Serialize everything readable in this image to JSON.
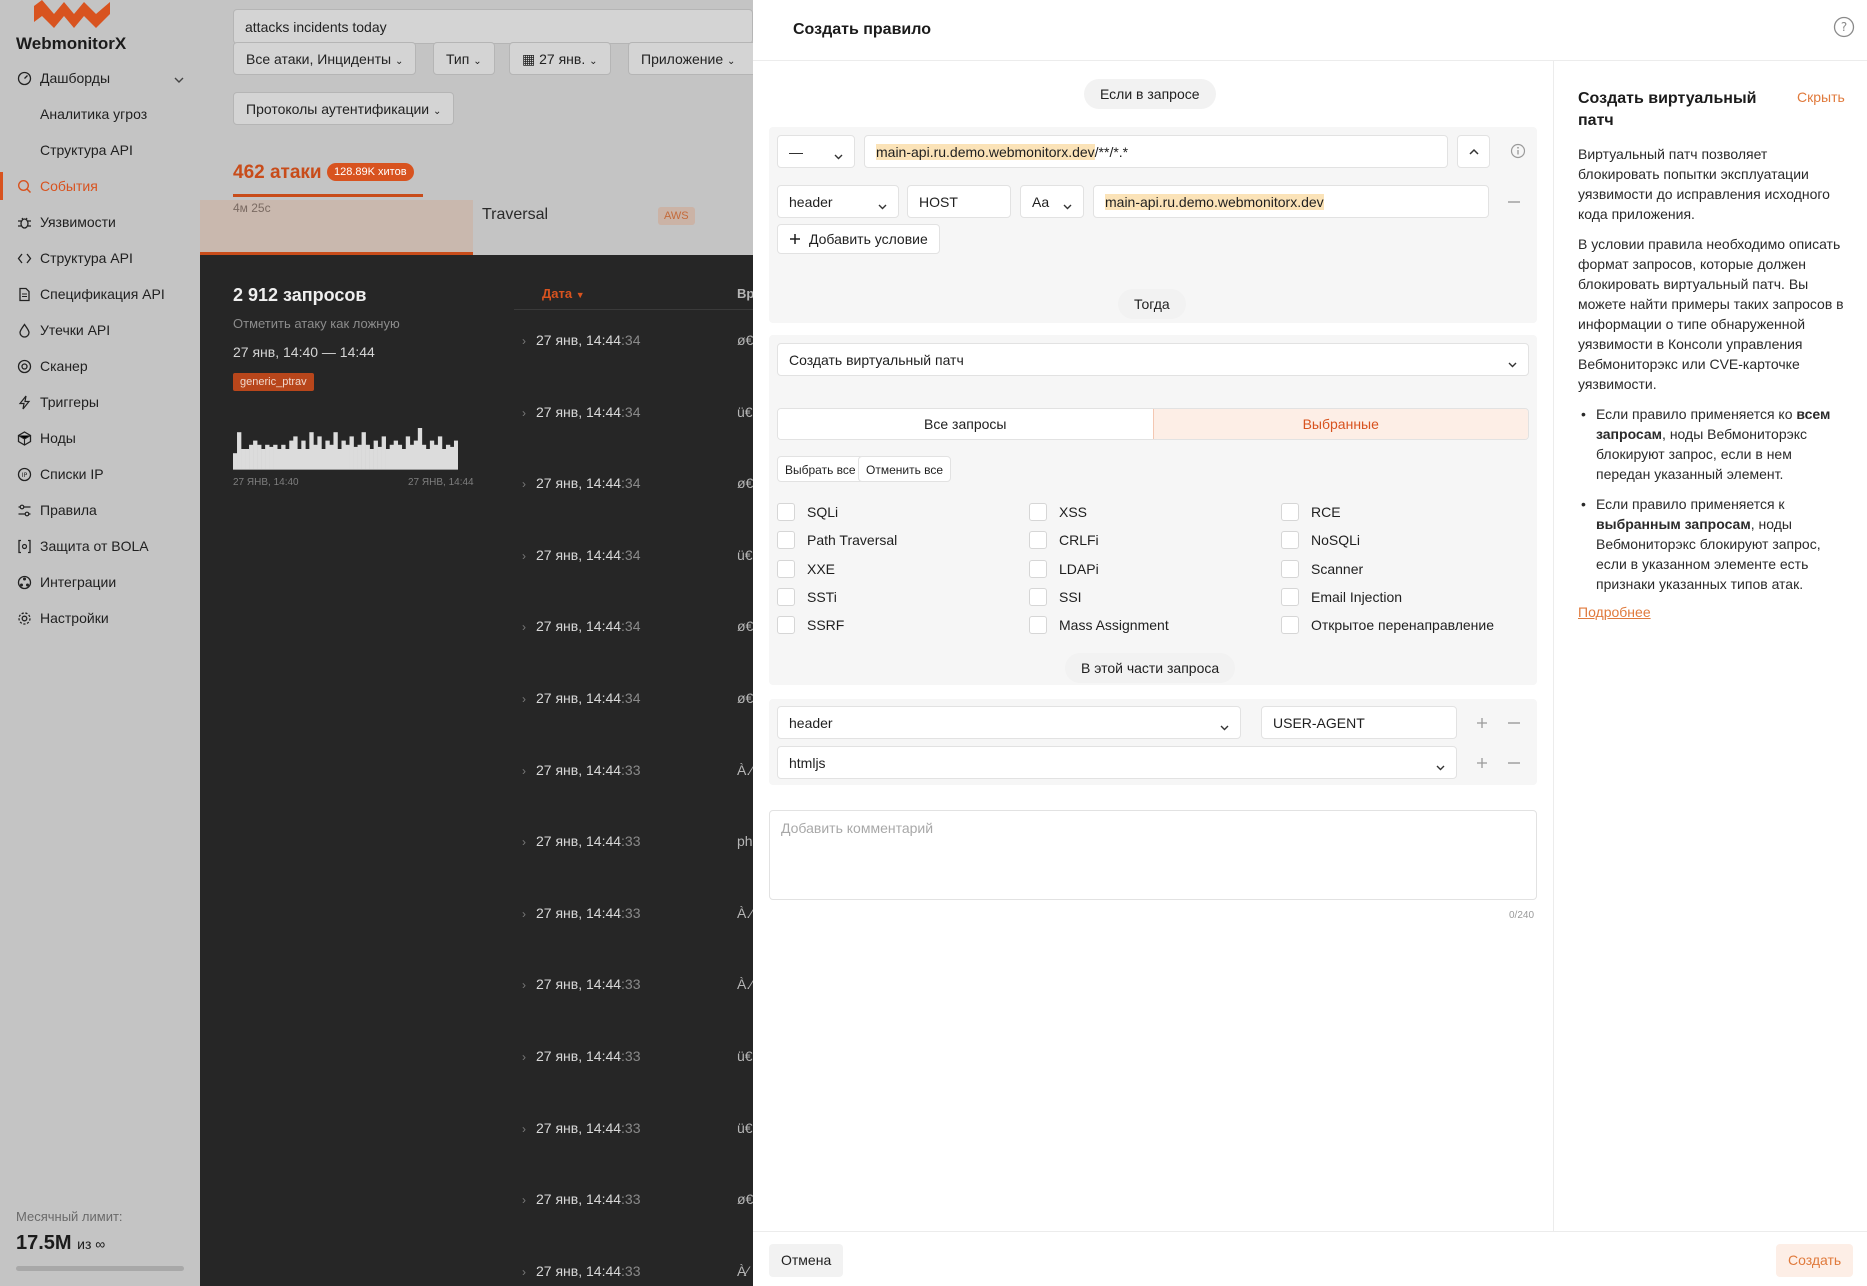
{
  "sidebar": {
    "logo": "WebmonitorX",
    "items": [
      {
        "label": "Дашборды",
        "icon": "dashboard-icon"
      },
      {
        "label": "Аналитика угроз",
        "sub": true
      },
      {
        "label": "Структура API",
        "sub": true
      },
      {
        "label": "События",
        "icon": "search-icon",
        "active": true
      },
      {
        "label": "Уязвимости",
        "icon": "bug-icon"
      },
      {
        "label": "Структура API",
        "icon": "code-icon"
      },
      {
        "label": "Спецификация API",
        "icon": "document-icon"
      },
      {
        "label": "Утечки API",
        "icon": "drop-icon"
      },
      {
        "label": "Сканер",
        "icon": "scanner-icon"
      },
      {
        "label": "Триггеры",
        "icon": "lightning-icon"
      },
      {
        "label": "Ноды",
        "icon": "nodes-icon"
      },
      {
        "label": "Списки IP",
        "icon": "ip-icon"
      },
      {
        "label": "Правила",
        "icon": "sliders-icon"
      },
      {
        "label": "Защита от BOLA",
        "icon": "brackets-icon"
      },
      {
        "label": "Интеграции",
        "icon": "integrations-icon"
      },
      {
        "label": "Настройки",
        "icon": "gear-icon"
      }
    ],
    "limit_label": "Месячный лимит:",
    "limit_value": "17.5M",
    "limit_of": "из ∞"
  },
  "main": {
    "search_value": "attacks incidents today",
    "filters": [
      "Все атаки, Инциденты",
      "Тип",
      "27 янв.",
      "Приложение",
      "Протоколы аутентификации"
    ],
    "attacks_count": "462 атаки",
    "hits_badge": "128.89K хитов",
    "tab_time": "4м 25с",
    "attack_type": "Traversal",
    "aws_badge": "AWS",
    "requests_title": "2 912 запросов",
    "mark_false": "Отметить атаку как ложную",
    "time_range": "27 янв, 14:40 — 14:44",
    "tag": "generic_ptrav",
    "mini_axis_start": "27 ЯНВ, 14:40",
    "mini_axis_end": "27 ЯНВ, 14:44",
    "mini_bars": [
      0.4,
      0.9,
      0.5,
      0.5,
      0.6,
      0.7,
      0.6,
      0.5,
      0.6,
      0.55,
      0.6,
      0.5,
      0.6,
      0.5,
      0.7,
      0.8,
      0.5,
      0.7,
      0.5,
      0.9,
      0.6,
      0.8,
      0.5,
      0.7,
      0.6,
      0.9,
      0.5,
      0.7,
      0.6,
      0.8,
      0.55,
      0.6,
      0.9,
      0.6,
      0.5,
      0.7,
      0.55,
      0.8,
      0.5,
      0.6,
      0.7,
      0.6,
      0.5,
      0.8,
      0.6,
      0.7,
      1.0,
      0.6,
      0.5,
      0.7,
      0.6,
      0.8,
      0.5,
      0.6,
      0.55,
      0.7
    ],
    "col_date": "Дата",
    "col_extra": "Вр",
    "rows": [
      {
        "date": "27 янв, 14:44",
        "sec": ":34",
        "extra": "ø€"
      },
      {
        "date": "27 янв, 14:44",
        "sec": ":34",
        "extra": "ü€"
      },
      {
        "date": "27 янв, 14:44",
        "sec": ":34",
        "extra": "ø€"
      },
      {
        "date": "27 янв, 14:44",
        "sec": ":34",
        "extra": "ü€"
      },
      {
        "date": "27 янв, 14:44",
        "sec": ":34",
        "extra": "ø€"
      },
      {
        "date": "27 янв, 14:44",
        "sec": ":34",
        "extra": "ø€"
      },
      {
        "date": "27 янв, 14:44",
        "sec": ":33",
        "extra": "À.⁄"
      },
      {
        "date": "27 янв, 14:44",
        "sec": ":33",
        "extra": "ph"
      },
      {
        "date": "27 янв, 14:44",
        "sec": ":33",
        "extra": "À.⁄"
      },
      {
        "date": "27 янв, 14:44",
        "sec": ":33",
        "extra": "À.⁄"
      },
      {
        "date": "27 янв, 14:44",
        "sec": ":33",
        "extra": "ü€"
      },
      {
        "date": "27 янв, 14:44",
        "sec": ":33",
        "extra": "ü€"
      },
      {
        "date": "27 янв, 14:44",
        "sec": ":33",
        "extra": "ø€"
      },
      {
        "date": "27 янв, 14:44",
        "sec": ":33",
        "extra": "À⁄"
      }
    ]
  },
  "modal": {
    "title": "Создать правило",
    "if_label": "Если в запросе",
    "method_value": "—",
    "path_host": "main-api.ru.demo.webmonitorx.dev",
    "path_rest": "/**/*.*",
    "cond_type": "header",
    "cond_name": "HOST",
    "cond_case": "Aa",
    "cond_value": "main-api.ru.demo.webmonitorx.dev",
    "add_condition": "Добавить условие",
    "then_label": "Тогда",
    "action_value": "Создать виртуальный патч",
    "seg_all": "Все запросы",
    "seg_selected": "Выбранные",
    "select_all": "Выбрать все",
    "deselect_all": "Отменить все",
    "attack_types": [
      [
        "SQLi",
        "Path Traversal",
        "XXE",
        "SSTi",
        "SSRF"
      ],
      [
        "XSS",
        "CRLFi",
        "LDAPi",
        "SSI",
        "Mass Assignment"
      ],
      [
        "RCE",
        "NoSQLi",
        "Scanner",
        "Email Injection",
        "Открытое перенаправление"
      ]
    ],
    "part_label": "В этой части запроса",
    "part_type": "header",
    "part_name": "USER-AGENT",
    "part_parser": "htmljs",
    "comment_placeholder": "Добавить комментарий",
    "comment_counter": "0/240",
    "cancel": "Отмена",
    "create": "Создать"
  },
  "help_panel": {
    "title": "Создать виртуальный патч",
    "hide": "Скрыть",
    "p1": "Виртуальный патч позволяет блокировать попытки эксплуатации уязвимости до исправления исходного кода приложения.",
    "p2": "В условии правила необходимо описать формат запросов, которые должен блокировать виртуальный патч. Вы можете найти примеры таких запросов в информации о типе обнаруженной уязвимости в Консоли управления Вебмониторэкс или CVE-карточке уязвимости.",
    "b1_pre": "Если правило применяется ко ",
    "b1_bold": "всем запросам",
    "b1_post": ", ноды Вебмониторэкс блокируют запрос, если в нем передан указанный элемент.",
    "b2_pre": "Если правило применяется к ",
    "b2_bold": "выбранным запросам",
    "b2_post": ", ноды Вебмониторэкс блокируют запрос, если в указанном элементе есть признаки указанных типов атак.",
    "more": "Подробнее"
  },
  "colors": {
    "accent": "#d8531f",
    "highlight": "#fbe3b8"
  }
}
